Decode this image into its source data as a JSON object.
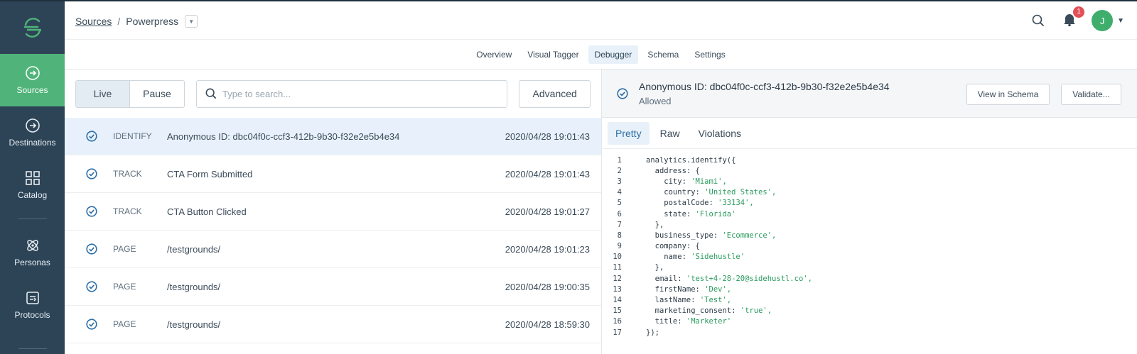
{
  "sidebar": {
    "items": [
      {
        "label": "Sources",
        "icon": "sources-icon"
      },
      {
        "label": "Destinations",
        "icon": "destinations-icon"
      },
      {
        "label": "Catalog",
        "icon": "catalog-icon"
      },
      {
        "label": "Personas",
        "icon": "personas-icon"
      },
      {
        "label": "Protocols",
        "icon": "protocols-icon"
      }
    ]
  },
  "breadcrumb": {
    "root": "Sources",
    "sep": "/",
    "current": "Powerpress"
  },
  "header": {
    "notifications": "1",
    "avatar_initial": "J"
  },
  "tabs": [
    "Overview",
    "Visual Tagger",
    "Debugger",
    "Schema",
    "Settings"
  ],
  "toolbar": {
    "live": "Live",
    "pause": "Pause",
    "search_placeholder": "Type to search...",
    "advanced": "Advanced"
  },
  "events": [
    {
      "type": "IDENTIFY",
      "name": "Anonymous ID: dbc04f0c-ccf3-412b-9b30-f32e2e5b4e34",
      "time": "2020/04/28 19:01:43"
    },
    {
      "type": "TRACK",
      "name": "CTA Form Submitted",
      "time": "2020/04/28 19:01:43"
    },
    {
      "type": "TRACK",
      "name": "CTA Button Clicked",
      "time": "2020/04/28 19:01:27"
    },
    {
      "type": "PAGE",
      "name": "/testgrounds/",
      "time": "2020/04/28 19:01:23"
    },
    {
      "type": "PAGE",
      "name": "/testgrounds/",
      "time": "2020/04/28 19:00:35"
    },
    {
      "type": "PAGE",
      "name": "/testgrounds/",
      "time": "2020/04/28 18:59:30"
    }
  ],
  "detail": {
    "title": "Anonymous ID: dbc04f0c-ccf3-412b-9b30-f32e2e5b4e34",
    "status": "Allowed",
    "view_schema": "View in Schema",
    "validate": "Validate...",
    "tabs": [
      "Pretty",
      "Raw",
      "Violations"
    ]
  },
  "code": [
    {
      "n": "1",
      "k": "analytics.identify({",
      "s": ""
    },
    {
      "n": "2",
      "k": "  address: {",
      "s": ""
    },
    {
      "n": "3",
      "k": "    city: ",
      "s": "'Miami',"
    },
    {
      "n": "4",
      "k": "    country: ",
      "s": "'United States',"
    },
    {
      "n": "5",
      "k": "    postalCode: ",
      "s": "'33134',"
    },
    {
      "n": "6",
      "k": "    state: ",
      "s": "'Florida'"
    },
    {
      "n": "7",
      "k": "  },",
      "s": ""
    },
    {
      "n": "8",
      "k": "  business_type: ",
      "s": "'Ecommerce',"
    },
    {
      "n": "9",
      "k": "  company: {",
      "s": ""
    },
    {
      "n": "10",
      "k": "    name: ",
      "s": "'Sidehustle'"
    },
    {
      "n": "11",
      "k": "  },",
      "s": ""
    },
    {
      "n": "12",
      "k": "  email: ",
      "s": "'test+4-28-20@sidehustl.co',"
    },
    {
      "n": "13",
      "k": "  firstName: ",
      "s": "'Dev',"
    },
    {
      "n": "14",
      "k": "  lastName: ",
      "s": "'Test',"
    },
    {
      "n": "15",
      "k": "  marketing_consent: ",
      "s": "'true',"
    },
    {
      "n": "16",
      "k": "  title: ",
      "s": "'Marketer'"
    },
    {
      "n": "17",
      "k": "});",
      "s": ""
    }
  ],
  "colors": {
    "sidebar": "#2d4457",
    "active": "#50b47a",
    "accent": "#2d6fa8"
  }
}
